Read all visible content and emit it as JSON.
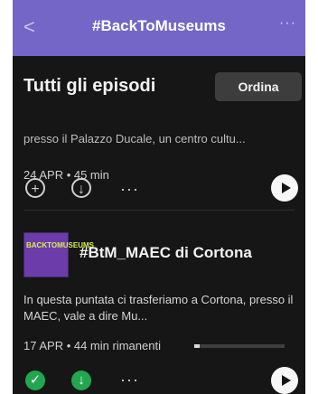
{
  "header": {
    "back_icon": "<",
    "title": "#BackToMuseums",
    "more_icon": "···"
  },
  "section": {
    "title": "Tutti gli episodi",
    "sort_label": "Ordina"
  },
  "episodes": [
    {
      "description": "presso il Palazzo Ducale, un centro cultu...",
      "meta": "24 APR • 45 min",
      "icons": {
        "add": "+",
        "download": "↓",
        "more": "···",
        "play": "play-icon"
      }
    },
    {
      "artwork_text": "BACKTOMUSEUMS",
      "title": "#BtM_MAEC di Cortona",
      "description": "In questa puntata ci trasferiamo a Cortona, presso il MAEC, vale a dire Mu...",
      "meta": "17 APR • 44 min rimanenti",
      "progress": 0.06,
      "icons": {
        "completed": "✓",
        "downloaded": "↓",
        "more": "···",
        "play": "play-icon"
      }
    }
  ]
}
